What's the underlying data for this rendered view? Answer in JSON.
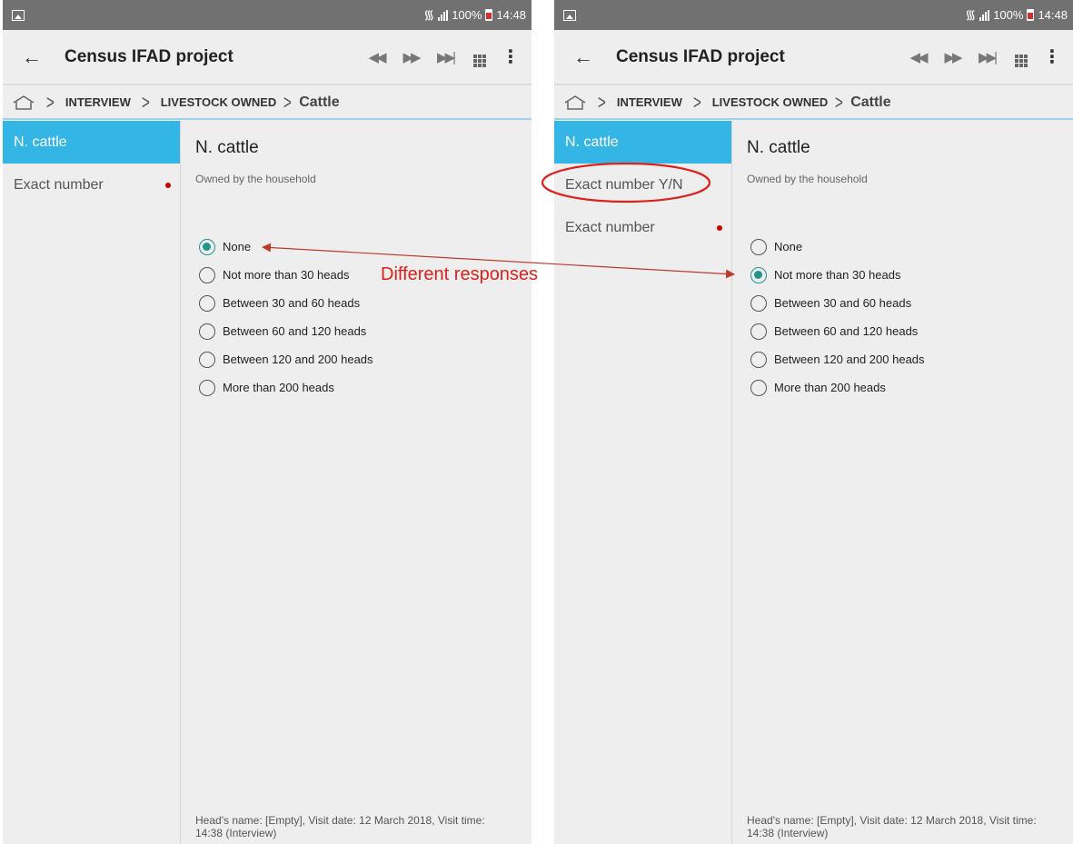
{
  "screens": [
    {
      "status": {
        "signal_pct": "100%",
        "time": "14:48"
      },
      "app": {
        "back": "←",
        "title": "Census IFAD project",
        "more": "⋮"
      },
      "breadcrumb": {
        "level1": "INTERVIEW",
        "level2": "LIVESTOCK OWNED",
        "current": "Cattle"
      },
      "sidebar": [
        {
          "label": "N. cattle",
          "active": true,
          "required_dot": false
        },
        {
          "label": "Exact number",
          "active": false,
          "required_dot": true
        }
      ],
      "question": {
        "title": "N. cattle",
        "hint": "Owned by the household"
      },
      "options": [
        {
          "label": "None",
          "selected": true
        },
        {
          "label": "Not more than 30 heads",
          "selected": false
        },
        {
          "label": "Between 30 and 60 heads",
          "selected": false
        },
        {
          "label": "Between 60 and 120 heads",
          "selected": false
        },
        {
          "label": "Between 120 and 200 heads",
          "selected": false
        },
        {
          "label": "More than 200 heads",
          "selected": false
        }
      ],
      "footer": "Head's name: [Empty], Visit date: 12 March 2018, Visit time: 14:38 (Interview)"
    },
    {
      "status": {
        "signal_pct": "100%",
        "time": "14:48"
      },
      "app": {
        "back": "←",
        "title": "Census IFAD project",
        "more": "⋮"
      },
      "breadcrumb": {
        "level1": "INTERVIEW",
        "level2": "LIVESTOCK OWNED",
        "current": "Cattle"
      },
      "sidebar": [
        {
          "label": "N. cattle",
          "active": true,
          "required_dot": false
        },
        {
          "label": "Exact number Y/N",
          "active": false,
          "required_dot": false
        },
        {
          "label": "Exact number",
          "active": false,
          "required_dot": true
        }
      ],
      "question": {
        "title": "N. cattle",
        "hint": "Owned by the household"
      },
      "options": [
        {
          "label": "None",
          "selected": false
        },
        {
          "label": "Not more than 30 heads",
          "selected": true
        },
        {
          "label": "Between 30 and 60 heads",
          "selected": false
        },
        {
          "label": "Between 60 and 120 heads",
          "selected": false
        },
        {
          "label": "Between 120 and 200 heads",
          "selected": false
        },
        {
          "label": "More than 200 heads",
          "selected": false
        }
      ],
      "footer": "Head's name: [Empty], Visit date: 12 March 2018, Visit time: 14:38 (Interview)"
    }
  ],
  "annotation": {
    "label": "Different responses",
    "color": "#e0201b"
  },
  "colors": {
    "active_item": "#33b5e5",
    "radio_selected": "#21948b",
    "required_dot": "#cc0000"
  }
}
